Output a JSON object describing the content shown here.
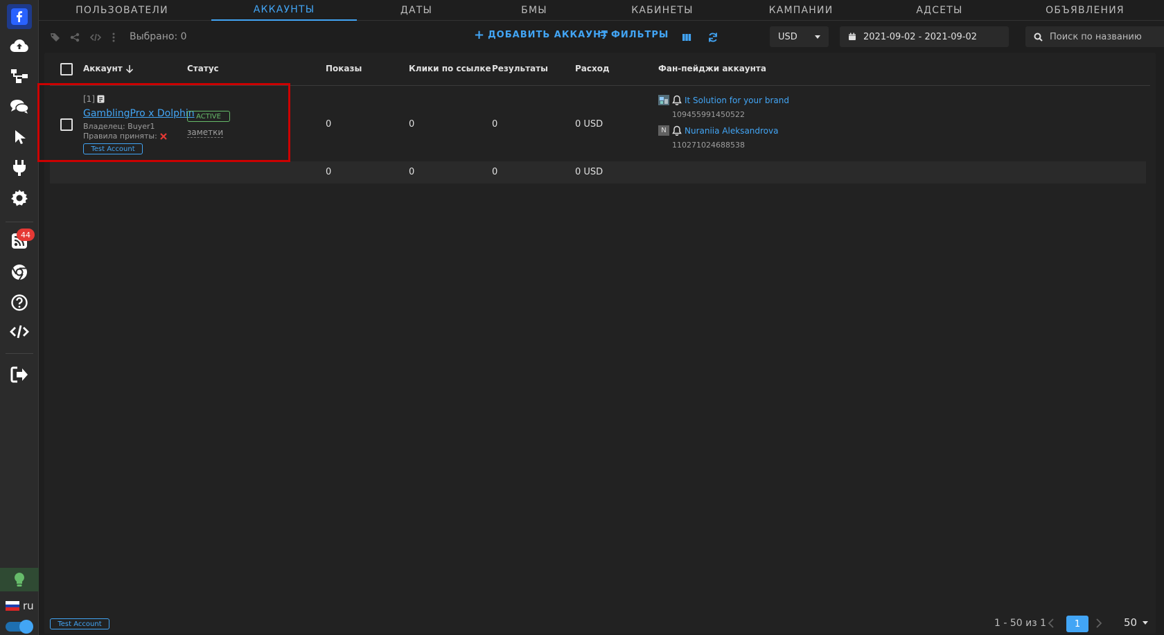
{
  "sidebar": {
    "badge_count": "44",
    "language": "ru"
  },
  "tabs": [
    {
      "label": "ПОЛЬЗОВАТЕЛИ"
    },
    {
      "label": "АККАУНТЫ"
    },
    {
      "label": "ДАТЫ"
    },
    {
      "label": "БМЫ"
    },
    {
      "label": "КАБИНЕТЫ"
    },
    {
      "label": "КАМПАНИИ"
    },
    {
      "label": "АДСЕТЫ"
    },
    {
      "label": "ОБЪЯВЛЕНИЯ"
    }
  ],
  "active_tab": "АККАУНТЫ",
  "toolbar": {
    "selected": "Выбрано: 0",
    "add_account": "ДОБАВИТЬ АККАУНТ",
    "filters": "ФИЛЬТРЫ",
    "currency": "USD",
    "date_range": "2021-09-02 - 2021-09-02",
    "search_placeholder": "Поиск по названию"
  },
  "table": {
    "headers": {
      "account": "Аккаунт",
      "status": "Статус",
      "impressions": "Показы",
      "clicks": "Клики по ссылке",
      "results": "Результаты",
      "spend": "Расход",
      "fanpages": "Фан-пейджи аккаунта"
    },
    "row": {
      "index": "[1]",
      "name": "GamblingPro x Dolphin",
      "owner": "Владелец: Buyer1",
      "rules": "Правила приняты:",
      "tag": "Test Account",
      "status": "ACTIVE",
      "notes": "заметки",
      "impressions": "0",
      "clicks": "0",
      "results": "0",
      "spend": "0 USD",
      "pages": [
        {
          "name": "It Solution for your brand",
          "id": "109455991450522",
          "avatar": ""
        },
        {
          "name": "Nuraniia Aleksandrova",
          "id": "110271024688538",
          "avatar": "N"
        }
      ]
    },
    "totals": {
      "impressions": "0",
      "clicks": "0",
      "results": "0",
      "spend": "0 USD"
    }
  },
  "footer": {
    "tag": "Test Account",
    "range": "1 - 50 из 1",
    "page": "1",
    "per_page": "50"
  },
  "colors": {
    "accent": "#42a5f5",
    "active_status": "#66bb6a",
    "badge": "#e53935",
    "highlight": "#cc0000"
  }
}
